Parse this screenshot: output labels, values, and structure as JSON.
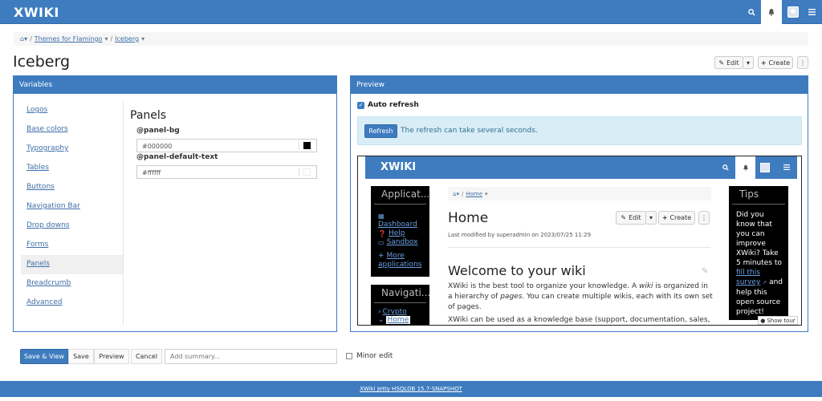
{
  "topbar": {
    "logo": "XWIKI"
  },
  "breadcrumb": {
    "items": [
      "Themes for Flamingo",
      "Iceberg"
    ]
  },
  "page": {
    "title": "Iceberg",
    "edit_label": "Edit",
    "create_label": "Create"
  },
  "variables": {
    "header": "Variables",
    "items": [
      "Logos",
      "Base colors",
      "Typography",
      "Tables",
      "Buttons",
      "Navigation Bar",
      "Drop downs",
      "Forms",
      "Panels",
      "Breadcrumb",
      "Advanced"
    ],
    "active": "Panels",
    "section_title": "Panels",
    "fields": [
      {
        "label": "@panel-bg",
        "value": "#000000",
        "swatch": "#000000"
      },
      {
        "label": "@panel-default-text",
        "value": "#ffffff",
        "swatch": "#ffffff"
      }
    ]
  },
  "preview": {
    "header": "Preview",
    "auto_refresh_label": "Auto refresh",
    "refresh_button": "Refresh",
    "refresh_note": "The refresh can take several seconds.",
    "frame": {
      "logo": "XWIKI",
      "apps_title": "Applicat...",
      "apps_links": [
        "Dashboard",
        "Help",
        "Sandbox"
      ],
      "more_apps_1": "More",
      "more_apps_2": "applications",
      "nav_title": "Navigati...",
      "nav_items": [
        "Crypto",
        "Home"
      ],
      "crumb": "Home",
      "page_title": "Home",
      "edit_label": "Edit",
      "create_label": "Create",
      "last_modified": "Last modified by superadmin on 2023/07/25 11:29",
      "welcome": "Welcome to your wiki",
      "para1_a": "XWiki is the best tool to organize your knowledge. A ",
      "para1_wiki": "wiki",
      "para1_b": " is organized in a hierarchy of ",
      "para1_pages": "pages",
      "para1_c": ". You can create multiple wikis, each with its own set of pages.",
      "para2": "XWiki can be used as a knowledge base (support, documentation, sales,",
      "tips_title": "Tips",
      "tips_text_1": "Did you know that you can improve XWiki? Take 5 minutes to",
      "tips_link": "fill this survey",
      "tips_text_2": "and help this open source project!",
      "show_tour": "Show tour"
    }
  },
  "actions": {
    "save_view": "Save & View",
    "save": "Save",
    "preview": "Preview",
    "cancel": "Cancel",
    "summary_placeholder": "Add summary...",
    "minor_edit": "Minor edit"
  },
  "footer": {
    "text": "XWiki Jetty HSQLDB 15.7-SNAPSHOT"
  }
}
